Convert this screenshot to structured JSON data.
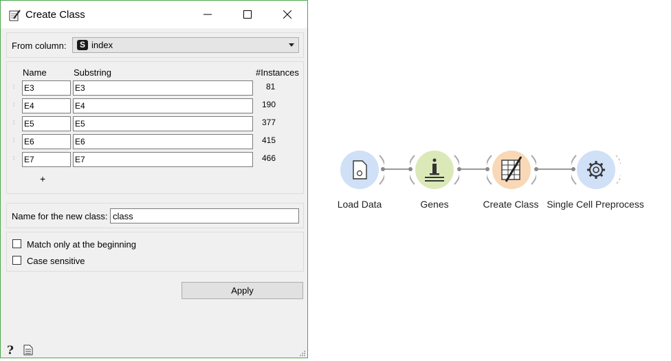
{
  "window": {
    "title": "Create Class",
    "from_column_label": "From column:",
    "column_type_badge": "S",
    "column_value": "index",
    "headers": {
      "name": "Name",
      "substring": "Substring",
      "instances": "#Instances"
    },
    "rows": [
      {
        "name": "E3",
        "substring": "E3",
        "count": "81"
      },
      {
        "name": "E4",
        "substring": "E4",
        "count": "190"
      },
      {
        "name": "E5",
        "substring": "E5",
        "count": "377"
      },
      {
        "name": "E6",
        "substring": "E6",
        "count": "415"
      },
      {
        "name": "E7",
        "substring": "E7",
        "count": "466"
      }
    ],
    "add_row_label": "+",
    "new_class_label": "Name for the new class:",
    "new_class_value": "class",
    "match_beginning_label": "Match only at the beginning",
    "case_sensitive_label": "Case sensitive",
    "apply_label": "Apply"
  },
  "workflow": {
    "nodes": [
      {
        "label": "Load Data",
        "icon": "file-icon",
        "color": "#cfe0f7"
      },
      {
        "label": "Genes",
        "icon": "info-icon",
        "color": "#dbe9b9"
      },
      {
        "label": "Create Class",
        "icon": "create-class-icon",
        "color": "#f8d8b6"
      },
      {
        "label": "Single Cell Preprocess",
        "icon": "gear-icon",
        "color": "#cfe0f7"
      }
    ]
  }
}
